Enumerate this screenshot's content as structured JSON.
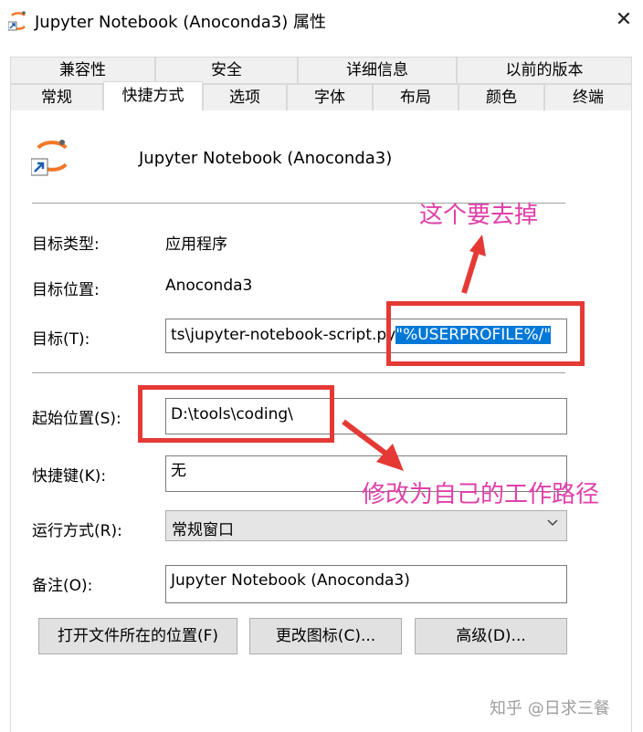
{
  "window": {
    "title": "Jupyter Notebook (Anoconda3) 属性",
    "close_glyph": "✕"
  },
  "tabs": {
    "row1": [
      "兼容性",
      "安全",
      "详细信息",
      "以前的版本"
    ],
    "row2": [
      "常规",
      "快捷方式",
      "选项",
      "字体",
      "布局",
      "颜色",
      "终端"
    ],
    "selected": "快捷方式"
  },
  "shortcut": {
    "name": "Jupyter Notebook (Anoconda3)",
    "target_type_label": "目标类型:",
    "target_type": "应用程序",
    "target_location_label": "目标位置:",
    "target_location": "Anoconda3",
    "target_label": "目标(T):",
    "target_value_plain": "ts\\jupyter-notebook-script.py",
    "target_value_selected": "\"%USERPROFILE%/\"",
    "start_in_label": "起始位置(S):",
    "start_in_value": "D:\\tools\\coding\\",
    "hotkey_label": "快捷键(K):",
    "hotkey_value": "无",
    "run_label": "运行方式(R):",
    "run_value": "常规窗口",
    "comment_label": "备注(O):",
    "comment_value": "Jupyter Notebook (Anoconda3)"
  },
  "buttons": {
    "open_location": "打开文件所在的位置(F)",
    "change_icon": "更改图标(C)...",
    "advanced": "高级(D)..."
  },
  "annotations": {
    "remove_note": "这个要去掉",
    "path_note": "修改为自己的工作路径",
    "color": "#e040a8",
    "box_color": "#e53935"
  },
  "watermark": "知乎 @日求三餐",
  "colors": {
    "selection": "#0078d7",
    "tab_bg": "#f0f0f0",
    "button_bg": "#e1e1e1"
  }
}
